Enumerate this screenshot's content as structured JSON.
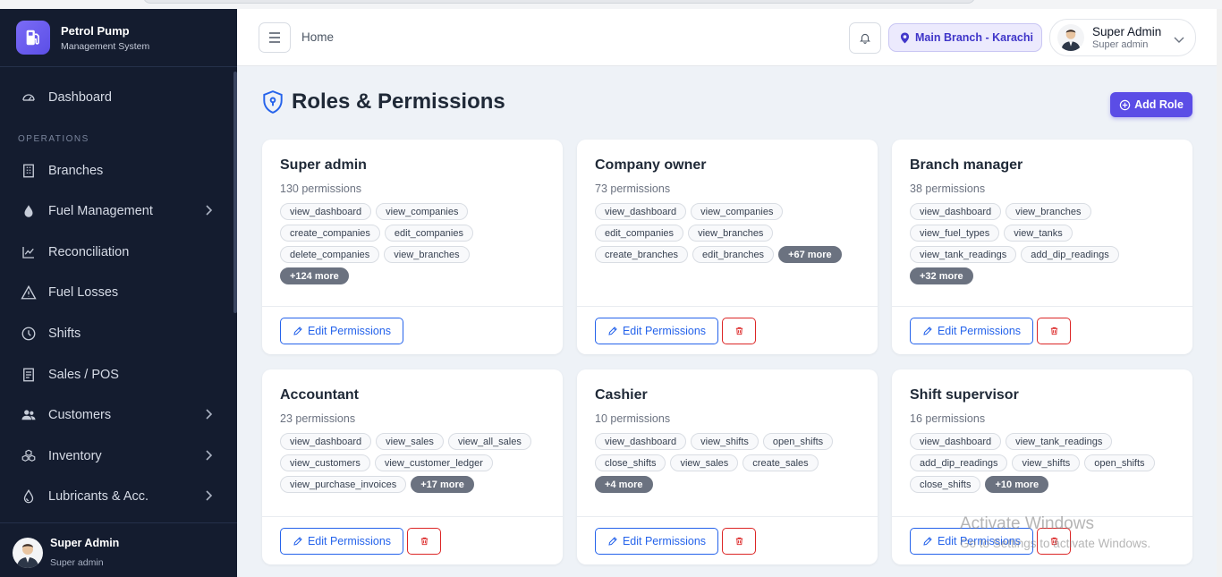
{
  "brand": {
    "title": "Petrol Pump",
    "subtitle": "Management System"
  },
  "sidebar": {
    "section_label": "OPERATIONS",
    "items": [
      {
        "label": "Dashboard",
        "icon": "gauge-icon"
      },
      {
        "label": "Branches",
        "icon": "building-icon"
      },
      {
        "label": "Fuel Management",
        "icon": "droplet-icon"
      },
      {
        "label": "Reconciliation",
        "icon": "chart-line-icon"
      },
      {
        "label": "Fuel Losses",
        "icon": "warning-icon"
      },
      {
        "label": "Shifts",
        "icon": "clock-icon"
      },
      {
        "label": "Sales / POS",
        "icon": "receipt-icon"
      },
      {
        "label": "Customers",
        "icon": "users-icon"
      },
      {
        "label": "Inventory",
        "icon": "boxes-icon"
      },
      {
        "label": "Lubricants & Acc.",
        "icon": "oil-drop-icon"
      }
    ],
    "user": {
      "name": "Super Admin",
      "role": "Super admin"
    }
  },
  "header": {
    "breadcrumb": "Home",
    "branch": "Main Branch - Karachi",
    "user": {
      "name": "Super Admin",
      "role": "Super admin"
    }
  },
  "page": {
    "title": "Roles & Permissions",
    "add_button": "Add Role",
    "edit_label": "Edit Permissions"
  },
  "roles": [
    {
      "name": "Super admin",
      "count": "130 permissions",
      "tags": [
        "view_dashboard",
        "view_companies",
        "create_companies",
        "edit_companies",
        "delete_companies",
        "view_branches"
      ],
      "more": "+124 more",
      "deletable": false
    },
    {
      "name": "Company owner",
      "count": "73 permissions",
      "tags": [
        "view_dashboard",
        "view_companies",
        "edit_companies",
        "view_branches",
        "create_branches",
        "edit_branches"
      ],
      "more": "+67 more",
      "deletable": true
    },
    {
      "name": "Branch manager",
      "count": "38 permissions",
      "tags": [
        "view_dashboard",
        "view_branches",
        "view_fuel_types",
        "view_tanks",
        "view_tank_readings",
        "add_dip_readings"
      ],
      "more": "+32 more",
      "deletable": true
    },
    {
      "name": "Accountant",
      "count": "23 permissions",
      "tags": [
        "view_dashboard",
        "view_sales",
        "view_all_sales",
        "view_customers",
        "view_customer_ledger",
        "view_purchase_invoices"
      ],
      "more": "+17 more",
      "deletable": true
    },
    {
      "name": "Cashier",
      "count": "10 permissions",
      "tags": [
        "view_dashboard",
        "view_shifts",
        "open_shifts",
        "close_shifts",
        "view_sales",
        "create_sales"
      ],
      "more": "+4 more",
      "deletable": true
    },
    {
      "name": "Shift supervisor",
      "count": "16 permissions",
      "tags": [
        "view_dashboard",
        "view_tank_readings",
        "add_dip_readings",
        "view_shifts",
        "open_shifts",
        "close_shifts"
      ],
      "more": "+10 more",
      "deletable": true
    }
  ],
  "watermark": {
    "title": "Activate Windows",
    "subtitle": "Go to Settings to activate Windows."
  },
  "colors": {
    "sidebar_bg": "#141c2f",
    "accent": "#5b4de6",
    "primary": "#2563eb",
    "danger": "#dc2626"
  }
}
